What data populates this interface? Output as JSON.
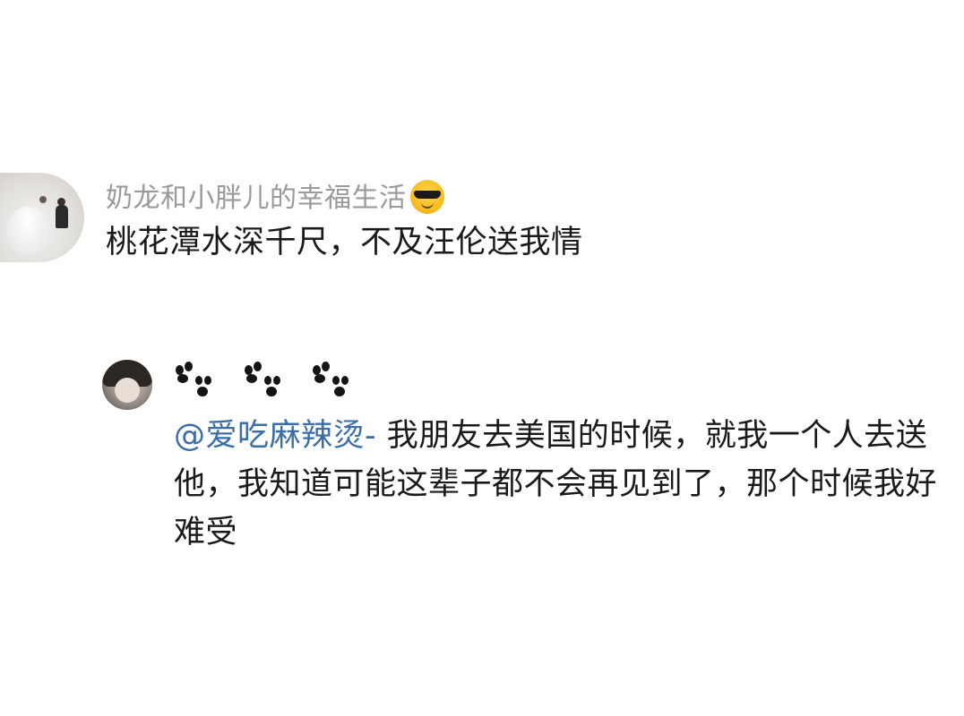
{
  "comment": {
    "username": "奶龙和小胖儿的幸福生活",
    "username_emoji": "sunglasses-emoji",
    "text": "桃花潭水深千尺，不及汪伦送我情"
  },
  "reply": {
    "username_icons": [
      "paw-prints-icon",
      "paw-prints-icon",
      "paw-prints-icon"
    ],
    "mention": "@爱吃麻辣烫-",
    "text": " 我朋友去美国的时候，就我一个人去送他，我知道可能这辈子都不会再见到了，那个时候我好难受"
  },
  "colors": {
    "username": "#9a9a9a",
    "text": "#1a1a1a",
    "mention": "#3b6ea8",
    "background": "#ffffff"
  }
}
